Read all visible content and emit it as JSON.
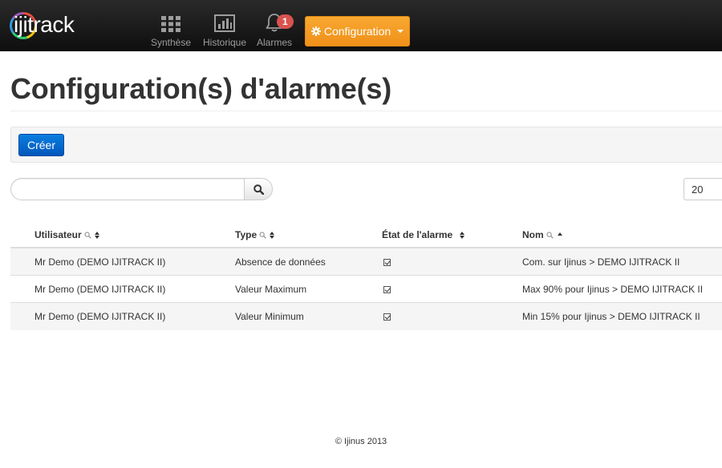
{
  "navbar": {
    "logo_text": "ijitrack",
    "items": [
      {
        "label": "Synthèse",
        "icon": "grid-icon"
      },
      {
        "label": "Historique",
        "icon": "bar-chart-icon"
      },
      {
        "label": "Alarmes",
        "icon": "bell-icon",
        "badge": "1"
      }
    ],
    "config_label": "Configuration",
    "config_color": "#f0901a"
  },
  "page": {
    "title": "Configuration(s) d'alarme(s)"
  },
  "toolbar": {
    "create_label": "Créer",
    "create_color": "#0257bb"
  },
  "search": {
    "value": "",
    "placeholder": ""
  },
  "page_size": "20",
  "table": {
    "columns": [
      "Utilisateur",
      "Type",
      "État de l'alarme",
      "Nom"
    ],
    "rows": [
      {
        "user": "Mr Demo (DEMO IJITRACK II)",
        "type": "Absence de données",
        "name": "Com. sur Ijinus > DEMO IJITRACK II"
      },
      {
        "user": "Mr Demo (DEMO IJITRACK II)",
        "type": "Valeur Maximum",
        "name": "Max 90% pour Ijinus > DEMO IJITRACK II"
      },
      {
        "user": "Mr Demo (DEMO IJITRACK II)",
        "type": "Valeur Minimum",
        "name": "Min 15% pour Ijinus > DEMO IJITRACK II"
      }
    ]
  },
  "footer": "© Ijinus 2013"
}
